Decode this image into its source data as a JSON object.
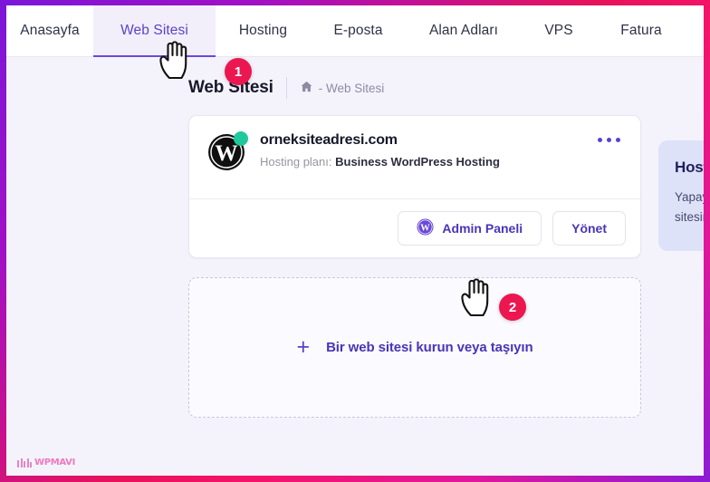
{
  "window": {
    "frame_gradient_start": "#7b16d9",
    "frame_gradient_mid": "#ec1361",
    "frame_gradient_end": "#8b1ad6",
    "background": "#f4f3fb"
  },
  "nav": {
    "tabs": [
      {
        "label": "Anasayfa",
        "active": false
      },
      {
        "label": "Web Sitesi",
        "active": true
      },
      {
        "label": "Hosting",
        "active": false
      },
      {
        "label": "E-posta",
        "active": false
      },
      {
        "label": "Alan Adları",
        "active": false
      },
      {
        "label": "VPS",
        "active": false
      },
      {
        "label": "Fatura",
        "active": false
      }
    ],
    "active_color": "#5b43c8",
    "active_bg": "#f2effb"
  },
  "header": {
    "title": "Web Sitesi",
    "breadcrumb": {
      "home_icon": "home-icon",
      "text": "- Web Sitesi"
    }
  },
  "site_card": {
    "icon": "wordpress-icon",
    "status": "online",
    "status_color": "#1fc99b",
    "domain": "orneksiteadresi.com",
    "plan_label": "Hosting planı:",
    "plan_value": "Business WordPress Hosting",
    "menu_icon": "kebab-menu-icon",
    "buttons": [
      {
        "label": "Admin Paneli",
        "icon": "wordpress-icon"
      },
      {
        "label": "Yönet",
        "icon": null
      }
    ]
  },
  "promo_card": {
    "title": "Hosting",
    "body": "Yapay zeka ile sitesine hayat verin.",
    "background": "#dde2f8"
  },
  "add_box": {
    "icon": "plus-icon",
    "label": "Bir web sitesi kurun veya taşıyın"
  },
  "step_badges": [
    {
      "number": "1"
    },
    {
      "number": "2"
    }
  ],
  "cursors": [
    {
      "name": "hand-pointer-cursor",
      "target": "tab-web-sitesi"
    },
    {
      "name": "hand-pointer-cursor",
      "target": "admin-paneli-button"
    }
  ],
  "watermark": {
    "text": "WPMAVI",
    "color": "#ef5fae"
  }
}
